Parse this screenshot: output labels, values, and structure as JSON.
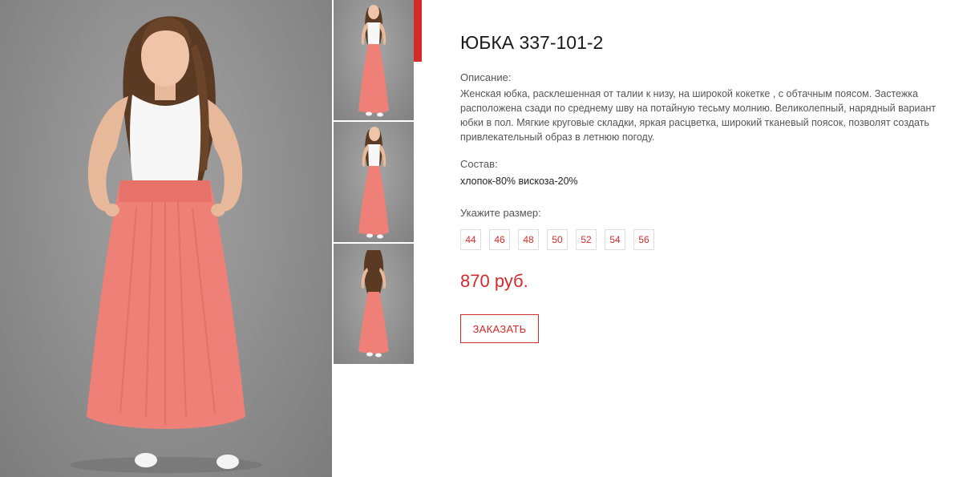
{
  "product": {
    "title": "ЮБКА 337-101-2",
    "description_label": "Описание:",
    "description": "Женская юбка, расклешенная от талии к низу, на широкой кокетке , с обтачным поясом. Застежка расположена сзади по среднему шву на потайную тесьму молнию. Великолепный, нарядный вариант юбки в пол. Мягкие круговые складки, яркая расцветка, широкий тканевый поясок, позволят создать привлекательный образ в летнюю погоду.",
    "composition_label": "Состав:",
    "composition": "хлопок-80% вискоза-20%",
    "size_label": "Укажите размер:",
    "sizes": [
      "44",
      "46",
      "48",
      "50",
      "52",
      "54",
      "56"
    ],
    "price": "870 руб.",
    "order_label": "ЗАКАЗАТЬ"
  },
  "gallery": {
    "main_image": "model-front-pink-maxi-skirt",
    "thumbnails": [
      "model-front",
      "model-three-quarter",
      "model-back"
    ],
    "active_thumbnail": 0
  },
  "colors": {
    "accent": "#d42a2a",
    "skirt": "#ef8078",
    "background_gray": "#8e8e8e"
  }
}
